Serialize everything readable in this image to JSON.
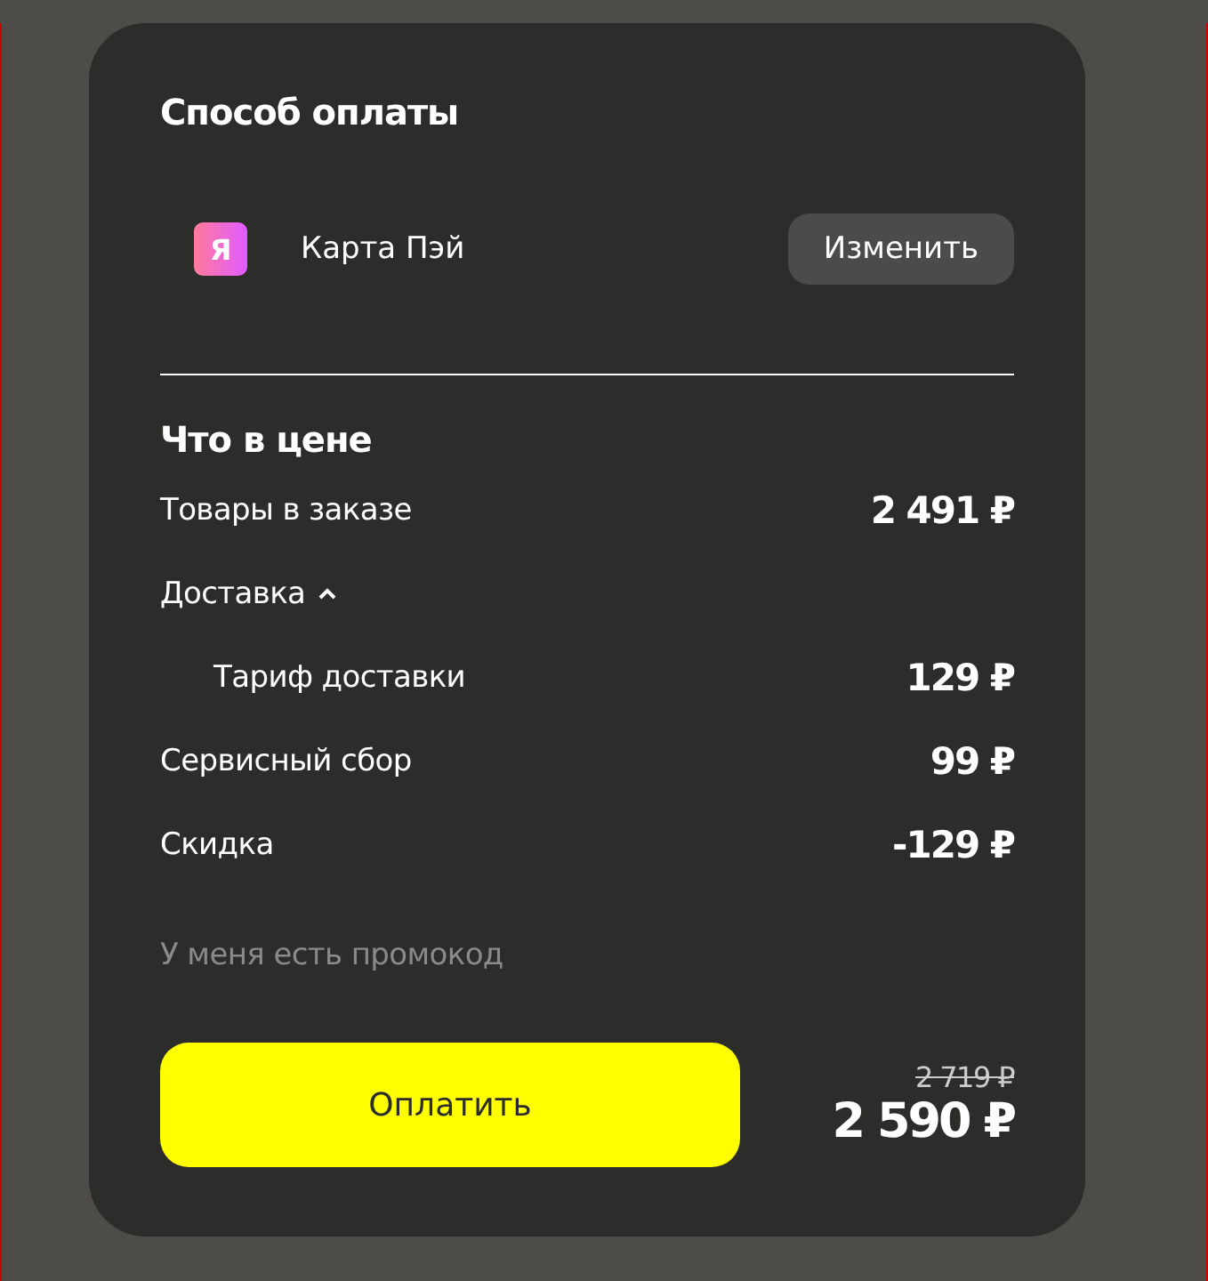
{
  "payment": {
    "title": "Способ оплаты",
    "logo": "Я",
    "method": "Карта Пэй",
    "change_button": "Изменить"
  },
  "price": {
    "title": "Что в цене",
    "rows": [
      {
        "kind": "line",
        "label": "Товары в заказе",
        "value": "2 491 ₽"
      },
      {
        "kind": "group",
        "label": "Доставка",
        "expanded": true,
        "children": [
          {
            "kind": "line",
            "label": "Тариф доставки",
            "value": "129 ₽"
          }
        ]
      },
      {
        "kind": "line",
        "label": "Сервисный сбор",
        "value": "99 ₽"
      },
      {
        "kind": "line",
        "label": "Скидка",
        "value": "-129 ₽"
      }
    ]
  },
  "promo_link": "У меня есть промокод",
  "pay_button": "Оплатить",
  "old_total": "2 719 ₽",
  "total": "2 590 ₽"
}
